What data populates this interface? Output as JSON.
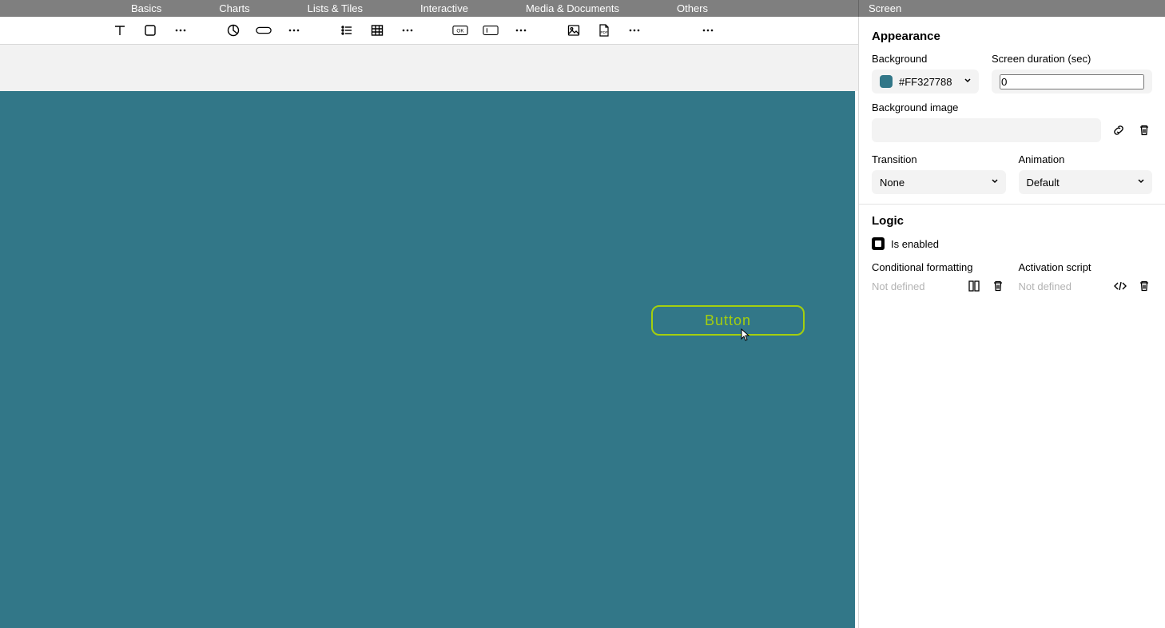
{
  "menubar": {
    "items": [
      "Basics",
      "Charts",
      "Lists & Tiles",
      "Interactive",
      "Media & Documents",
      "Others"
    ],
    "panel_tab": "Screen"
  },
  "toolbar": {
    "groups": [
      [
        "text",
        "shape",
        "more"
      ],
      [
        "pie",
        "button-pill",
        "more"
      ],
      [
        "list",
        "table",
        "more"
      ],
      [
        "ok-box",
        "input-box",
        "more"
      ],
      [
        "image",
        "pdf",
        "more"
      ],
      [
        "more"
      ]
    ]
  },
  "canvas": {
    "bg": "#327788",
    "button_label": "Button"
  },
  "panel": {
    "appearance": {
      "title": "Appearance",
      "background_label": "Background",
      "background_value": "#FF327788",
      "duration_label": "Screen duration (sec)",
      "duration_value": "0",
      "bgimage_label": "Background image",
      "transition_label": "Transition",
      "transition_value": "None",
      "animation_label": "Animation",
      "animation_value": "Default"
    },
    "logic": {
      "title": "Logic",
      "enabled_label": "Is enabled",
      "cond_label": "Conditional formatting",
      "cond_value": "Not defined",
      "script_label": "Activation script",
      "script_value": "Not defined"
    }
  }
}
